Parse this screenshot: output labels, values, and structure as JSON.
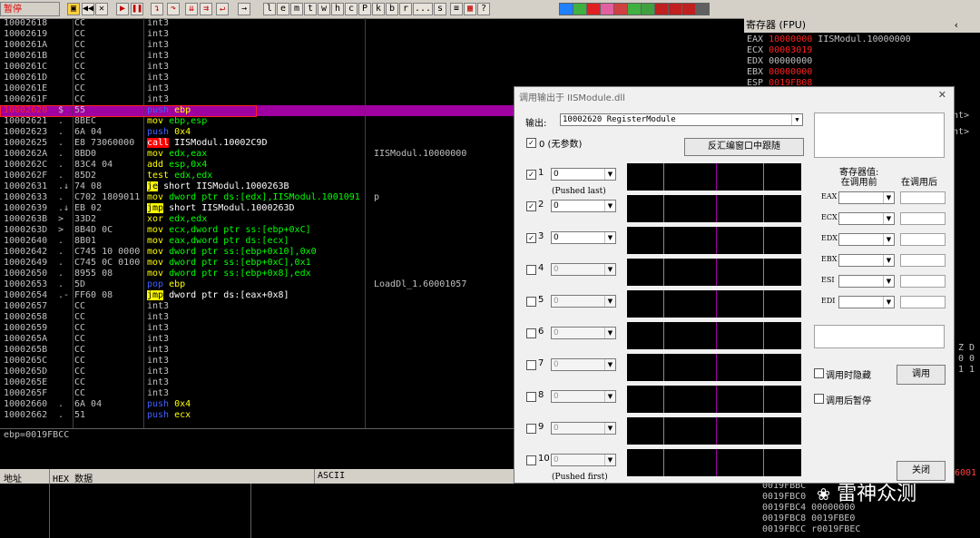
{
  "toolbar": {
    "status": "暂停",
    "buttons": [
      "l",
      "e",
      "m",
      "t",
      "w",
      "h",
      "c",
      "P",
      "k",
      "b",
      "r",
      "...",
      "s"
    ],
    "plugin_colors": [
      "#2080ff",
      "#40b040",
      "#e02020",
      "#e060a0",
      "#d04040",
      "#40b040",
      "#40a040",
      "#c02020",
      "#c02020",
      "#c02020",
      "#606060"
    ]
  },
  "disasm": {
    "rows": [
      {
        "addr": "10002618",
        "flag": "",
        "hex": "CC",
        "ins": "int3",
        "cmt": ""
      },
      {
        "addr": "10002619",
        "flag": "",
        "hex": "CC",
        "ins": "int3",
        "cmt": ""
      },
      {
        "addr": "1000261A",
        "flag": "",
        "hex": "CC",
        "ins": "int3",
        "cmt": ""
      },
      {
        "addr": "1000261B",
        "flag": "",
        "hex": "CC",
        "ins": "int3",
        "cmt": ""
      },
      {
        "addr": "1000261C",
        "flag": "",
        "hex": "CC",
        "ins": "int3",
        "cmt": ""
      },
      {
        "addr": "1000261D",
        "flag": "",
        "hex": "CC",
        "ins": "int3",
        "cmt": ""
      },
      {
        "addr": "1000261E",
        "flag": "",
        "hex": "CC",
        "ins": "int3",
        "cmt": ""
      },
      {
        "addr": "1000261F",
        "flag": "",
        "hex": "CC",
        "ins": "int3",
        "cmt": ""
      },
      {
        "addr": "10002620",
        "flag": "$",
        "hex": "55",
        "ins": "push ebp",
        "cmt": "",
        "sel": true
      },
      {
        "addr": "10002621",
        "flag": ".",
        "hex": "8BEC",
        "ins": "mov ebp,esp",
        "cmt": ""
      },
      {
        "addr": "10002623",
        "flag": ".",
        "hex": "6A 04",
        "ins": "push 0x4",
        "cmt": ""
      },
      {
        "addr": "10002625",
        "flag": ".",
        "hex": "E8 73060000",
        "ins": "call IISModul.10002C9D",
        "cmt": ""
      },
      {
        "addr": "1000262A",
        "flag": ".",
        "hex": "8BD0",
        "ins": "mov edx,eax",
        "cmt": "IISModul.10000000"
      },
      {
        "addr": "1000262C",
        "flag": ".",
        "hex": "83C4 04",
        "ins": "add esp,0x4",
        "cmt": ""
      },
      {
        "addr": "1000262F",
        "flag": ".",
        "hex": "85D2",
        "ins": "test edx,edx",
        "cmt": ""
      },
      {
        "addr": "10002631",
        "flag": ".↓",
        "hex": "74 08",
        "ins": "je short IISModul.1000263B",
        "cmt": ""
      },
      {
        "addr": "10002633",
        "flag": ".",
        "hex": "C702 1809011",
        "ins": "mov dword ptr ds:[edx],IISModul.1001091",
        "cmt": "p"
      },
      {
        "addr": "10002639",
        "flag": ".↓",
        "hex": "EB 02",
        "ins": "jmp short IISModul.1000263D",
        "cmt": ""
      },
      {
        "addr": "1000263B",
        "flag": ">",
        "hex": "33D2",
        "ins": "xor edx,edx",
        "cmt": ""
      },
      {
        "addr": "1000263D",
        "flag": ">",
        "hex": "8B4D 0C",
        "ins": "mov ecx,dword ptr ss:[ebp+0xC]",
        "cmt": ""
      },
      {
        "addr": "10002640",
        "flag": ".",
        "hex": "8B01",
        "ins": "mov eax,dword ptr ds:[ecx]",
        "cmt": ""
      },
      {
        "addr": "10002642",
        "flag": ".",
        "hex": "C745 10 0000",
        "ins": "mov dword ptr ss:[ebp+0x10],0x0",
        "cmt": ""
      },
      {
        "addr": "10002649",
        "flag": ".",
        "hex": "C745 0C 0100",
        "ins": "mov dword ptr ss:[ebp+0xC],0x1",
        "cmt": ""
      },
      {
        "addr": "10002650",
        "flag": ".",
        "hex": "8955 08",
        "ins": "mov dword ptr ss:[ebp+0x8],edx",
        "cmt": ""
      },
      {
        "addr": "10002653",
        "flag": ".",
        "hex": "5D",
        "ins": "pop ebp",
        "cmt": "LoadDl_1.60001057"
      },
      {
        "addr": "10002654",
        "flag": ".-",
        "hex": "FF60 08",
        "ins": "jmp dword ptr ds:[eax+0x8]",
        "cmt": ""
      },
      {
        "addr": "10002657",
        "flag": "",
        "hex": "CC",
        "ins": "int3",
        "cmt": ""
      },
      {
        "addr": "10002658",
        "flag": "",
        "hex": "CC",
        "ins": "int3",
        "cmt": ""
      },
      {
        "addr": "10002659",
        "flag": "",
        "hex": "CC",
        "ins": "int3",
        "cmt": ""
      },
      {
        "addr": "1000265A",
        "flag": "",
        "hex": "CC",
        "ins": "int3",
        "cmt": ""
      },
      {
        "addr": "1000265B",
        "flag": "",
        "hex": "CC",
        "ins": "int3",
        "cmt": ""
      },
      {
        "addr": "1000265C",
        "flag": "",
        "hex": "CC",
        "ins": "int3",
        "cmt": ""
      },
      {
        "addr": "1000265D",
        "flag": "",
        "hex": "CC",
        "ins": "int3",
        "cmt": ""
      },
      {
        "addr": "1000265E",
        "flag": "",
        "hex": "CC",
        "ins": "int3",
        "cmt": ""
      },
      {
        "addr": "1000265F",
        "flag": "",
        "hex": "CC",
        "ins": "int3",
        "cmt": ""
      },
      {
        "addr": "10002660",
        "flag": ".",
        "hex": "6A 04",
        "ins": "push 0x4",
        "cmt": ""
      },
      {
        "addr": "10002662",
        "flag": ".",
        "hex": "51",
        "ins": "push ecx",
        "cmt": ""
      }
    ],
    "info": "ebp=0019FBCC"
  },
  "dump": {
    "col_addr": "地址",
    "col_hex": "HEX 数据",
    "col_ascii": "ASCII"
  },
  "registers": {
    "title": "寄存器 (FPU)",
    "rows": [
      {
        "name": "EAX",
        "value": "10000000",
        "note": "IISModul.10000000",
        "red": true
      },
      {
        "name": "ECX",
        "value": "00003019",
        "note": "",
        "red": true
      },
      {
        "name": "EDX",
        "value": "00000000",
        "note": "",
        "red": false
      },
      {
        "name": "EBX",
        "value": "00000000",
        "note": "",
        "red": true
      },
      {
        "name": "ESP",
        "value": "0019FB08",
        "note": "",
        "red": true
      }
    ],
    "right_frag": [
      "nt>",
      "nt>"
    ],
    "flags_frag": [
      "Z D",
      "0 0",
      "1 1"
    ]
  },
  "stack": {
    "rows": [
      "0019FBBC",
      "0019FBC0",
      "0019FBC4 00000000",
      "0019FBC8 0019FBE0",
      "0019FBCC r0019FBEC"
    ]
  },
  "watermark": "雷神众测",
  "dialog": {
    "title": "调用输出于 IISModule.dll",
    "output_label": "输出:",
    "output_value": "10002620  RegisterModule",
    "no_args_label": "0 (无参数)",
    "follow_btn": "反汇编窗口中跟随",
    "pushed_last": "(Pushed last)",
    "pushed_first": "(Pushed first)",
    "args": [
      {
        "n": "1",
        "val": "0",
        "checked": true
      },
      {
        "n": "2",
        "val": "0",
        "checked": true
      },
      {
        "n": "3",
        "val": "0",
        "checked": true
      },
      {
        "n": "4",
        "val": "0",
        "checked": false
      },
      {
        "n": "5",
        "val": "0",
        "checked": false
      },
      {
        "n": "6",
        "val": "0",
        "checked": false
      },
      {
        "n": "7",
        "val": "0",
        "checked": false
      },
      {
        "n": "8",
        "val": "0",
        "checked": false
      },
      {
        "n": "9",
        "val": "0",
        "checked": false
      },
      {
        "n": "10",
        "val": "0",
        "checked": false
      }
    ],
    "reg_header_left": "寄存器值:\n在调用前",
    "reg_header_right": "在调用后",
    "reg_names": [
      "EAX",
      "ECX",
      "EDX",
      "EBX",
      "ESI",
      "EDI"
    ],
    "hide_on_call": "调用时隐藏",
    "pause_after": "调用后暂停",
    "call_btn": "调用",
    "close_btn": "关闭",
    "close_x": "✕"
  }
}
